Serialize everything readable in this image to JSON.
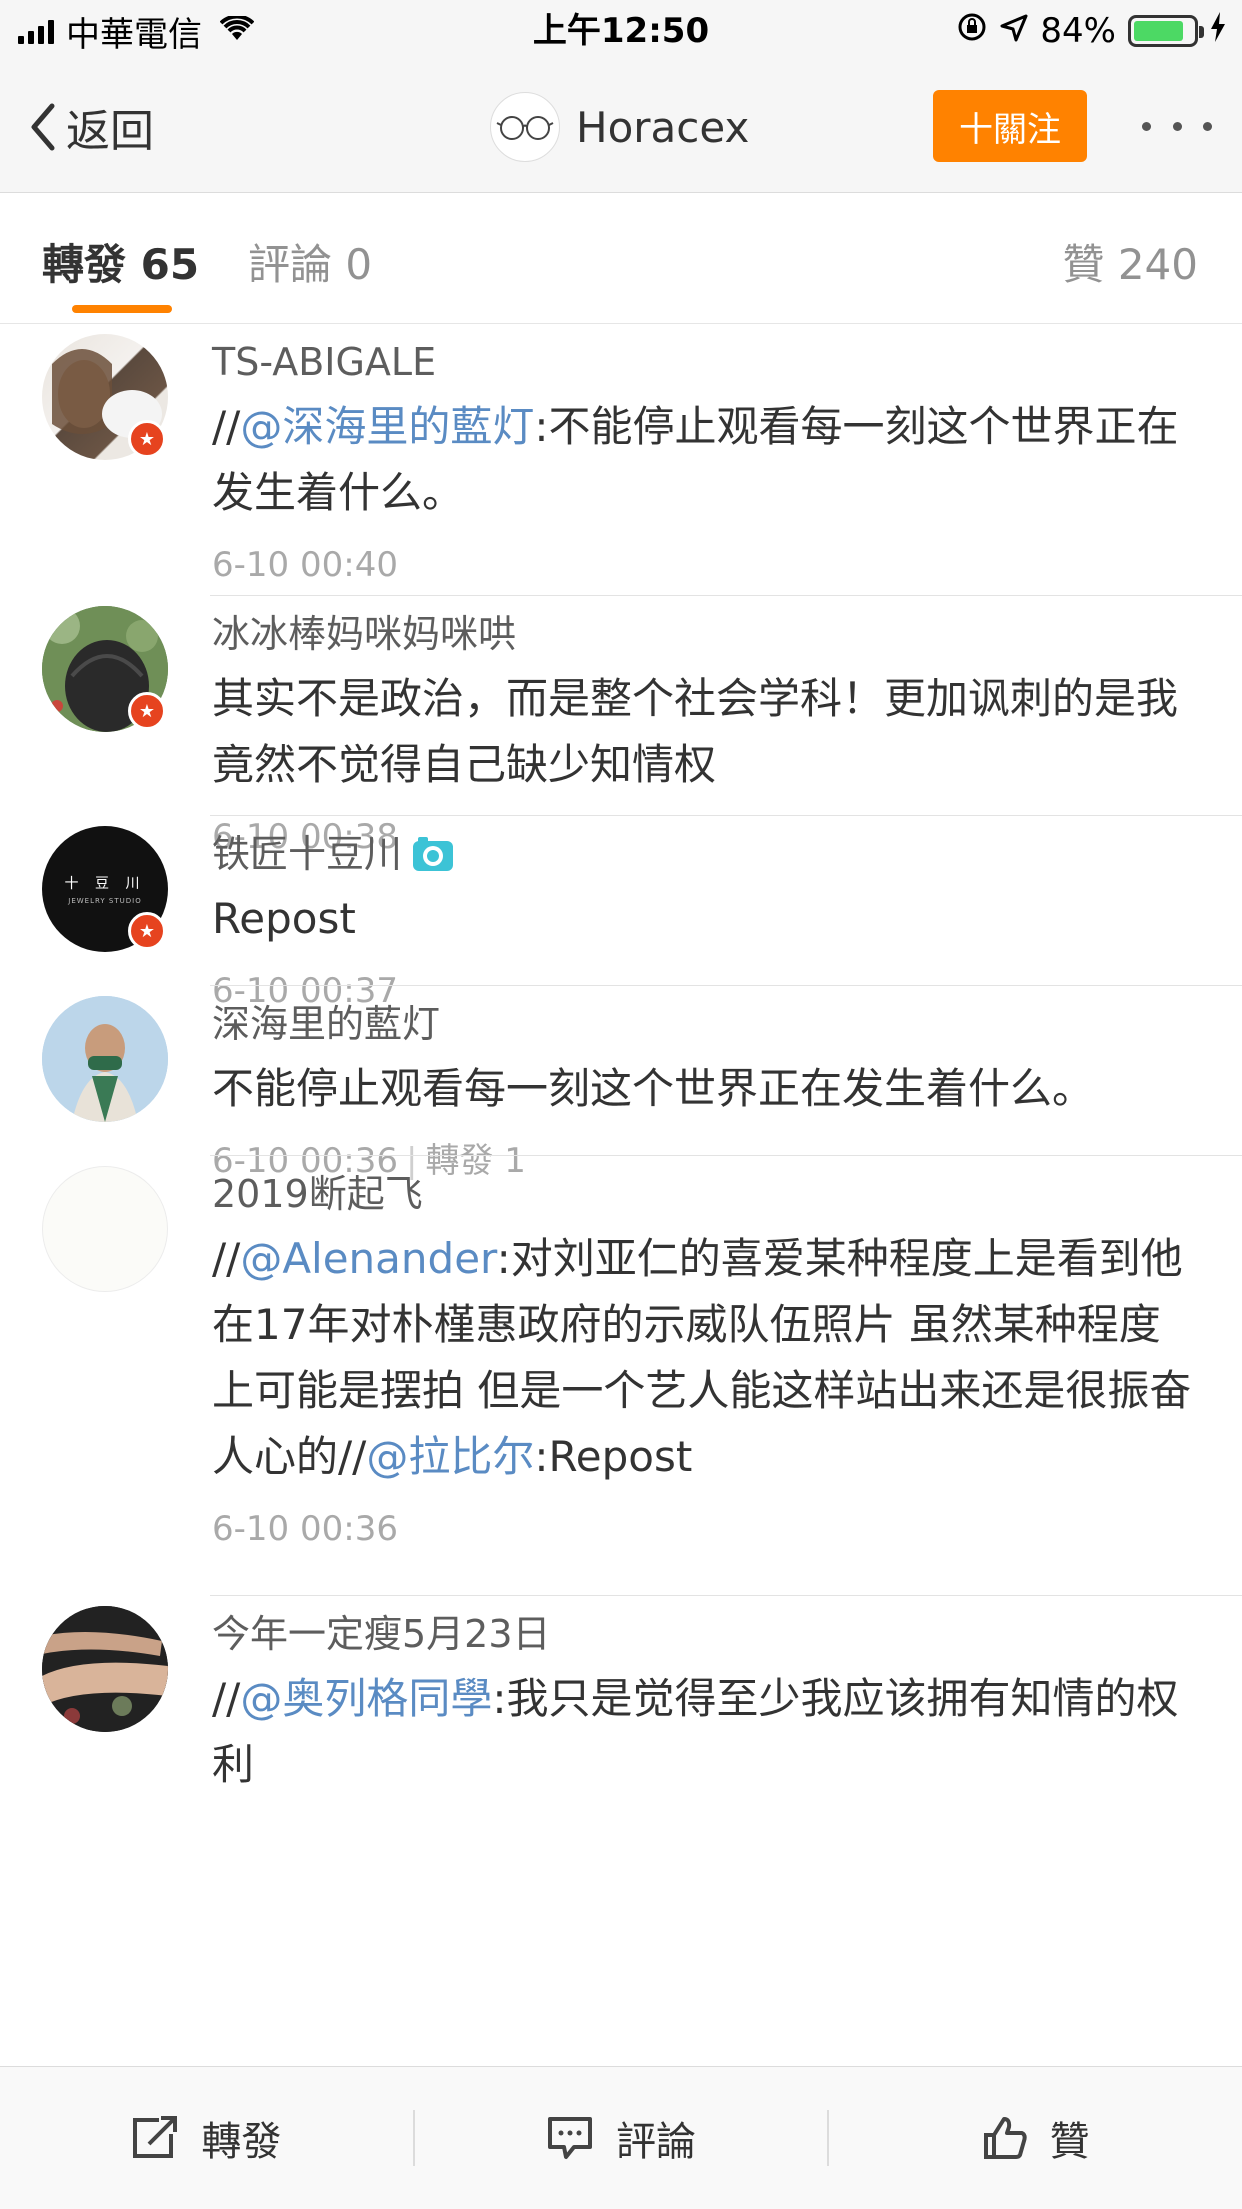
{
  "status_bar": {
    "carrier": "中華電信",
    "time": "上午12:50",
    "battery_percent": "84%",
    "battery_level": 0.84,
    "accent_battery": "#4cd964"
  },
  "nav": {
    "back_label": "返回",
    "title": "Horacex",
    "follow_label": "十關注",
    "follow_color": "#ff8200"
  },
  "tabs": {
    "reposts": "轉發 65",
    "comments": "評論 0",
    "likes": "贊 240",
    "active": "reposts"
  },
  "items": [
    {
      "username": "TS-ABIGALE",
      "content_prefix": "//",
      "mention": "@深海里的藍灯",
      "content_rest": ":不能停止观看每一刻这个世界正在发生着什么。",
      "time": "6-10 00:40",
      "verified": true
    },
    {
      "username": "冰冰棒妈咪妈咪哄",
      "content": "其实不是政治，而是整个社会学科！更加讽刺的是我竟然不觉得自己缺少知情权",
      "time": "6-10 00:38",
      "verified": true
    },
    {
      "username": "铁匠十豆川",
      "content": "Repost",
      "time": "6-10 00:37",
      "verified": true,
      "avatar_text": "十 豆 川",
      "avatar_subtext": "JEWELRY STUDIO"
    },
    {
      "username": "深海里的藍灯",
      "content": "不能停止观看每一刻这个世界正在发生着什么。",
      "time": "6-10 00:36",
      "repost_count": "轉發 1",
      "verified": false
    },
    {
      "username": "2019断起飞",
      "content_prefix": "//",
      "mention": "@Alenander",
      "content_mid": ":对刘亚仁的喜爱某种程度上是看到他在17年对朴槿惠政府的示威队伍照片 虽然某种程度上可能是摆拍 但是一个艺人能这样站出来还是很振奋人心的//",
      "mention2": "@拉比尔",
      "content_rest": ":Repost",
      "time": "6-10 00:36",
      "verified": false
    },
    {
      "username": "今年一定瘦5月23日",
      "content_prefix": "//",
      "mention": "@奥列格同學",
      "content_rest": ":我只是觉得至少我应该拥有知情的权利",
      "verified": false
    }
  ],
  "toolbar": {
    "repost_label": "轉發",
    "comment_label": "評論",
    "like_label": "贊"
  },
  "colors": {
    "mention": "#5a8bc3",
    "verified_badge": "#e6431f",
    "active_tab_underline": "#ff8200"
  }
}
